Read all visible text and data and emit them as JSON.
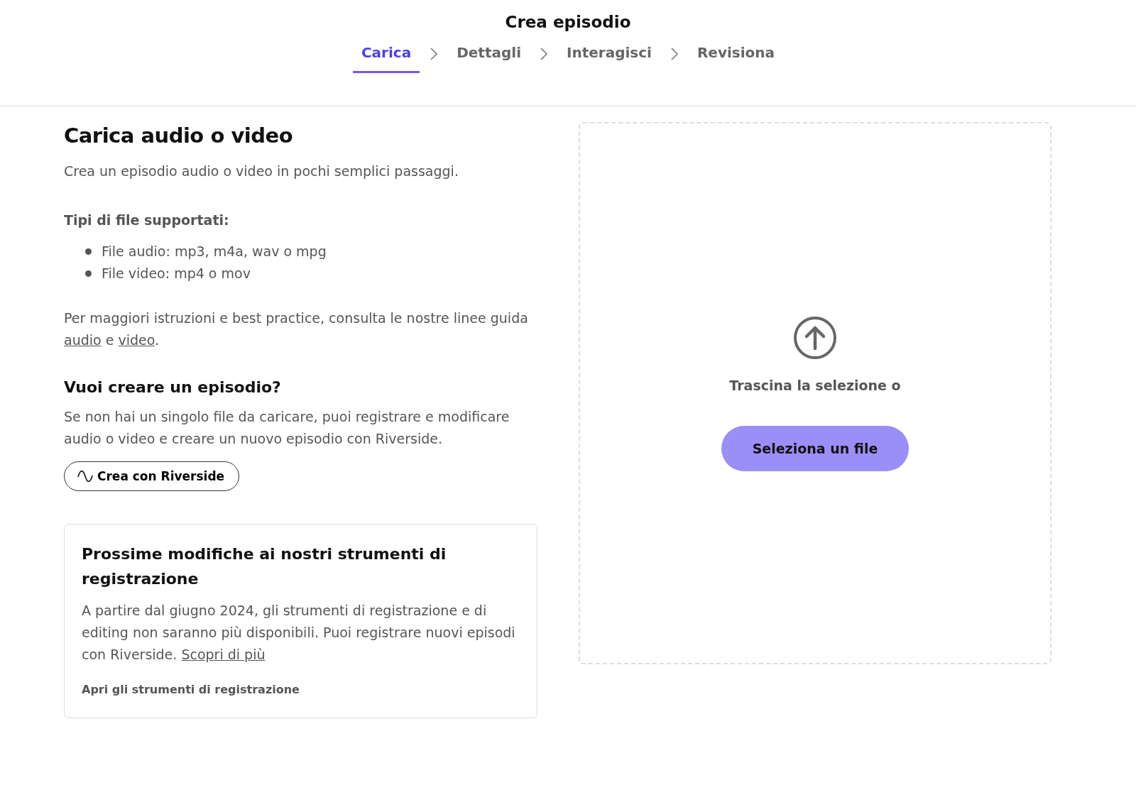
{
  "header": {
    "title": "Crea episodio"
  },
  "steps": [
    {
      "label": "Carica",
      "selected": true
    },
    {
      "label": "Dettagli",
      "selected": false
    },
    {
      "label": "Interagisci",
      "selected": false
    },
    {
      "label": "Revisiona",
      "selected": false
    }
  ],
  "upload": {
    "heading": "Carica audio o video",
    "intro": "Crea un episodio audio o video in pochi semplici passaggi.",
    "types_heading": "Tipi di file supportati:",
    "types": [
      "File audio: mp3, m4a, wav o mpg",
      "File video: mp4 o mov"
    ],
    "guide_text": "Per maggiori istruzioni e best practice, consulta le nostre linee guida",
    "guide_link_audio": "audio",
    "guide_and": "e",
    "guide_link_video": "video",
    "guide_end": "."
  },
  "create": {
    "heading": "Vuoi creare un episodio?",
    "text": "Se non hai un singolo file da caricare, puoi registrare e modificare audio o video e creare un nuovo episodio con Riverside.",
    "button": "Crea con Riverside"
  },
  "notice": {
    "title": "Prossime modifiche ai nostri strumenti di registrazione",
    "text": "A partire dal giugno 2024, gli strumenti di registrazione e di editing non saranno più disponibili. Puoi registrare nuovi episodi con Riverside.",
    "link": "Scopri di più",
    "action": "Apri gli strumenti di registrazione"
  },
  "dropzone": {
    "hint": "Trascina la selezione o",
    "button": "Seleziona un file"
  }
}
